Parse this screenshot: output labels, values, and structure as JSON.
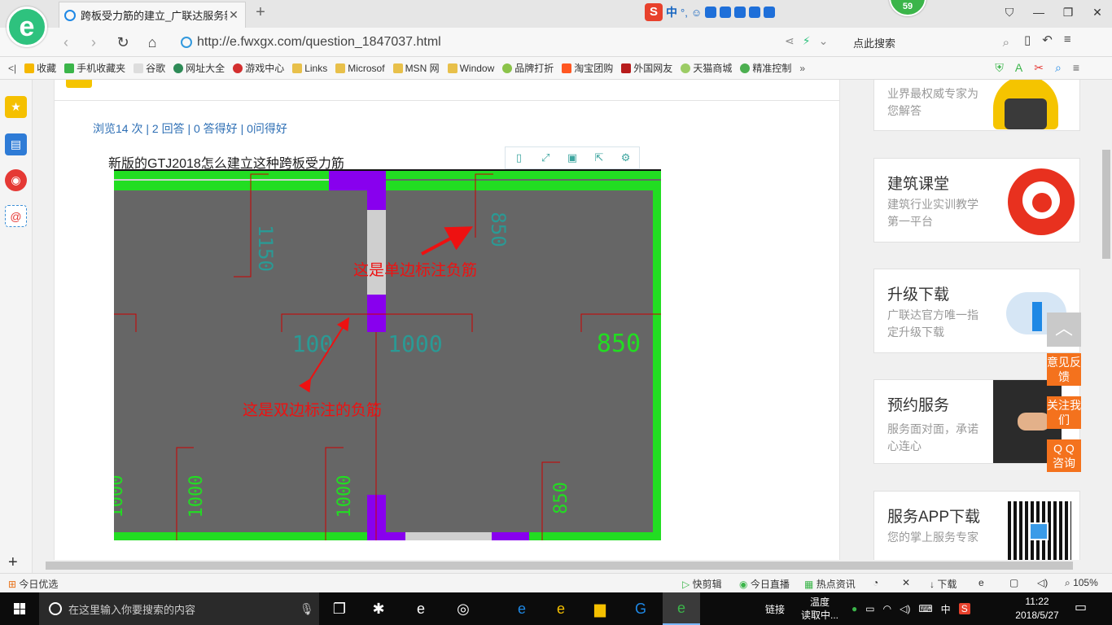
{
  "browser": {
    "tab_title": "跨板受力筋的建立_广联达服务新",
    "url": "http://e.fwxgx.com/question_1847037.html",
    "search_placeholder": "点此搜索",
    "badge_count": "59",
    "ime_label": "中"
  },
  "bookmarks": [
    {
      "label": "收藏",
      "icon": "star-icon"
    },
    {
      "label": "手机收藏夹",
      "icon": "phone-icon"
    },
    {
      "label": "谷歌",
      "icon": "page-icon"
    },
    {
      "label": "网址大全",
      "icon": "globe-icon"
    },
    {
      "label": "游戏中心",
      "icon": "game-icon"
    },
    {
      "label": "Links",
      "icon": "folder-icon"
    },
    {
      "label": "Microsof",
      "icon": "folder-icon"
    },
    {
      "label": "MSN 网",
      "icon": "folder-icon"
    },
    {
      "label": "Window",
      "icon": "folder-icon"
    },
    {
      "label": "品牌打折",
      "icon": "leaf-icon"
    },
    {
      "label": "淘宝团购",
      "icon": "taobao-icon"
    },
    {
      "label": "外国网友",
      "icon": "flag-icon"
    },
    {
      "label": "天猫商城",
      "icon": "leaf-icon"
    },
    {
      "label": "精准控制",
      "icon": "wechat-icon"
    }
  ],
  "question": {
    "stats_views": "浏览14 次",
    "stats_answers": "2 回答",
    "stats_good_answers": "0 答得好",
    "stats_good_questions": "0问得好",
    "text": "新版的GTJ2018怎么建立这种跨板受力筋"
  },
  "drawing": {
    "annotation_single": "这是单边标注负筋",
    "annotation_double": "这是双边标注的负筋",
    "dim_1150": "1150",
    "dim_850_top": "850",
    "dim_100": "100",
    "dim_1000_mid": "1000",
    "dim_850_right": "850",
    "dim_1000_b1": "1000",
    "dim_1000_b2": "1000",
    "dim_1000_b3": "1000",
    "dim_850_bottom": "850"
  },
  "sidebar_cards": [
    {
      "title": "",
      "desc": "业界最权威专家为您解答"
    },
    {
      "title": "建筑课堂",
      "desc": "建筑行业实训教学第一平台"
    },
    {
      "title": "升级下载",
      "desc": "广联达官方唯一指定升级下载"
    },
    {
      "title": "预约服务",
      "desc": "服务面对面，承诺心连心"
    },
    {
      "title": "服务APP下载",
      "desc": "您的掌上服务专家"
    }
  ],
  "float_buttons": [
    "意见反馈",
    "关注我们",
    "Q Q 咨询"
  ],
  "statusbar": {
    "left": "今日优选",
    "quick_edit": "快剪辑",
    "today_live": "今日直播",
    "hot_news": "热点资讯",
    "download": "下载",
    "zoom": "105%"
  },
  "taskbar": {
    "search_placeholder": "在这里输入你要搜索的内容",
    "links": "链接",
    "temp_line1": "温度",
    "temp_line2": "读取中...",
    "ime": "中",
    "time": "11:22",
    "date": "2018/5/27"
  },
  "colors": {
    "slab_fill": "#666666",
    "wall_green": "#22dd22",
    "wall_purple": "#8800ee",
    "rebar_red": "#cc0000",
    "arrow_red": "#ee1111",
    "link_blue": "#2e6fb5",
    "float_orange": "#f4721d"
  }
}
